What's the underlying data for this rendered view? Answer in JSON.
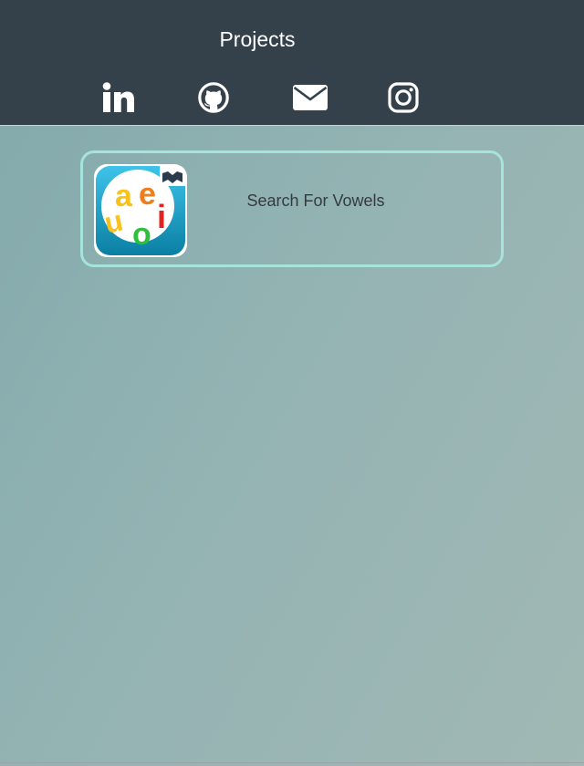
{
  "header": {
    "title": "Projects",
    "social": [
      {
        "name": "linkedin",
        "icon": "linkedin-icon"
      },
      {
        "name": "github",
        "icon": "github-icon"
      },
      {
        "name": "email",
        "icon": "envelope-icon"
      },
      {
        "name": "instagram",
        "icon": "instagram-icon"
      }
    ]
  },
  "projects": [
    {
      "title": "Search For Vowels",
      "icon": "vowels-app-icon",
      "icon_letters": [
        "a",
        "e",
        "u",
        "o",
        "i"
      ]
    }
  ],
  "colors": {
    "header_bg": "#35414a",
    "card_border": "#a6e3d8",
    "text": "#333b40"
  }
}
